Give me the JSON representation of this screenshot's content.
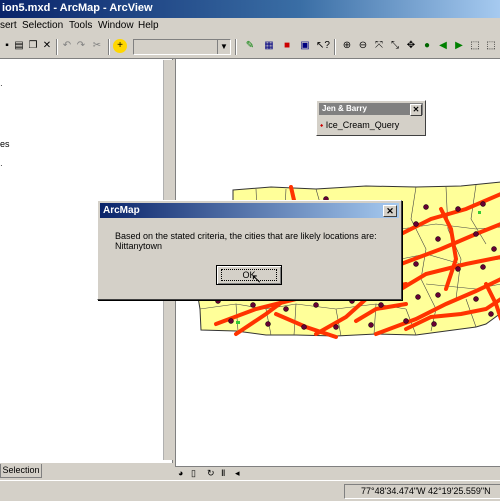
{
  "window": {
    "title": "ion5.mxd - ArcMap - ArcView"
  },
  "menu": {
    "items": [
      "sert",
      "Selection",
      "Tools",
      "Window",
      "Help"
    ]
  },
  "toolbar": {
    "icons": [
      "insert-icon",
      "selection-icon",
      "paste-icon",
      "delete-icon",
      "undo-icon",
      "redo-icon",
      "cut-icon",
      "add-data-icon",
      "editor-icon",
      "arctoolbox-icon",
      "help-icon",
      "zoom-in-icon",
      "zoom-out-icon",
      "fixed-zoom-icon",
      "full-extent-icon",
      "globe-icon",
      "back-icon",
      "forward-icon"
    ],
    "scale_value": ""
  },
  "toc": {
    "fragment_text": "es",
    "tabs": {
      "selection": "Selection"
    }
  },
  "floating_toolbar": {
    "title": "Jen & Barry",
    "button_label": "Ice_Cream_Query"
  },
  "dialog": {
    "title": "ArcMap",
    "message_line1": "Based on the stated criteria, the cities that are likely locations are:",
    "message_line2": "Nittanytown",
    "ok_label": "OK"
  },
  "status": {
    "coordinates": "77°48'34.474\"W  42°19'25.559\"N"
  },
  "colors": {
    "map_fill": "#ffff99",
    "roads": "#ff3300",
    "cities": "#660033",
    "county_lines": "#444444"
  }
}
